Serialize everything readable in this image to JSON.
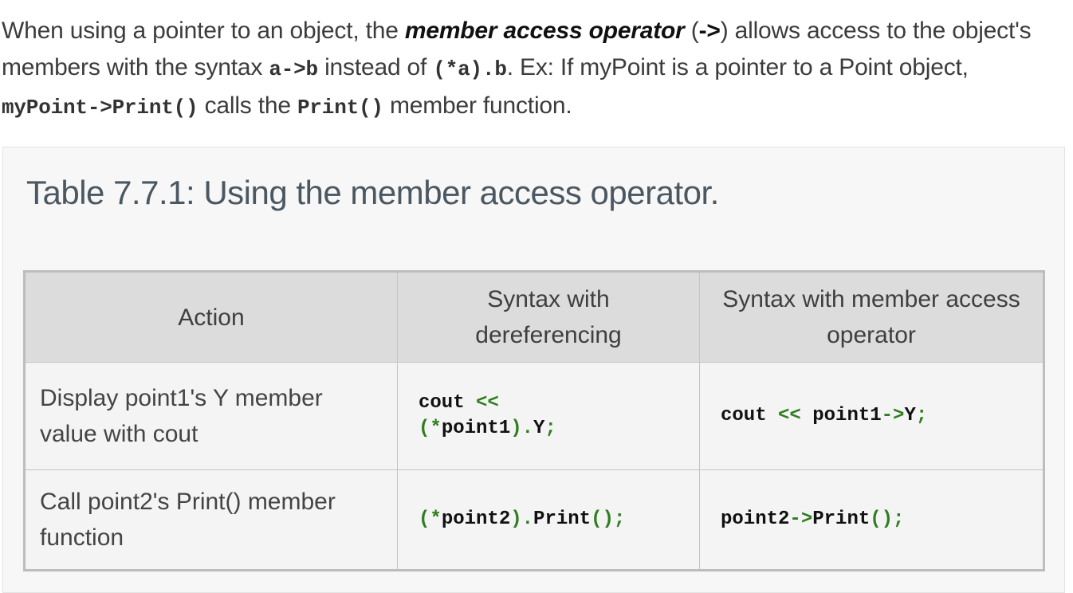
{
  "intro": {
    "p1": "When using a pointer to an object, the ",
    "term": "member access operator",
    "p2": " (",
    "arrow": "->",
    "p3": ") allows access to the object's members with the syntax ",
    "code_arrow": "a->b",
    "p4": " instead of ",
    "code_deref": "(*a).b",
    "p5": ". Ex: If myPoint is a pointer to a Point object, ",
    "code_call": "myPoint->Print()",
    "p6": " calls the ",
    "code_fn": "Print()",
    "p7": " member function."
  },
  "table": {
    "title": "Table 7.7.1: Using the member access operator.",
    "headers": [
      "Action",
      "Syntax with dereferencing",
      "Syntax with member access operator"
    ],
    "rows": [
      {
        "action": "Display point1's Y member value with cout",
        "deref": [
          "cout",
          "<<",
          "(*",
          "point1",
          ").",
          "Y",
          ";"
        ],
        "arrow": [
          "cout",
          "<<",
          "point1",
          "->",
          "Y",
          ";"
        ]
      },
      {
        "action": "Call point2's Print() member function",
        "deref": [
          "(*",
          "point2",
          ").",
          "Print",
          "();"
        ],
        "arrow": [
          "point2",
          "->",
          "Print",
          "();"
        ]
      }
    ]
  },
  "colors": {
    "operator": "#2e7d1e",
    "header_bg": "#dcdcdc",
    "cell_bg": "#f4f4f4"
  }
}
